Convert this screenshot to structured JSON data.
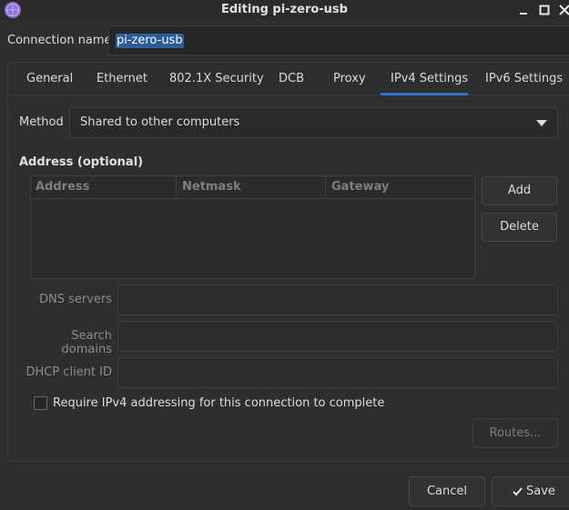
{
  "window": {
    "title": "Editing pi-zero-usb",
    "icons": {
      "app": "network-app-icon",
      "minimize": "minimize-icon",
      "maximize": "maximize-icon",
      "close": "close-icon"
    }
  },
  "connection": {
    "label": "Connection name",
    "value": "pi-zero-usb"
  },
  "tabs": [
    {
      "label": "General"
    },
    {
      "label": "Ethernet"
    },
    {
      "label": "802.1X Security"
    },
    {
      "label": "DCB"
    },
    {
      "label": "Proxy"
    },
    {
      "label": "IPv4 Settings",
      "active": true
    },
    {
      "label": "IPv6 Settings"
    }
  ],
  "ipv4": {
    "method_label": "Method",
    "method_value": "Shared to other computers",
    "address_heading": "Address (optional)",
    "columns": [
      "Address",
      "Netmask",
      "Gateway"
    ],
    "rows": [],
    "add_label": "Add",
    "delete_label": "Delete",
    "dns_label": "DNS servers",
    "dns_value": "",
    "search_label": "Search domains",
    "search_value": "",
    "dhcp_label": "DHCP client ID",
    "dhcp_value": "",
    "require_label": "Require IPv4 addressing for this connection to complete",
    "require_checked": false,
    "routes_label": "Routes..."
  },
  "footer": {
    "cancel_label": "Cancel",
    "save_label": "Save"
  },
  "colors": {
    "accent": "#2d74c8",
    "selection": "#2a5d9a",
    "background": "#2e2e2e"
  }
}
